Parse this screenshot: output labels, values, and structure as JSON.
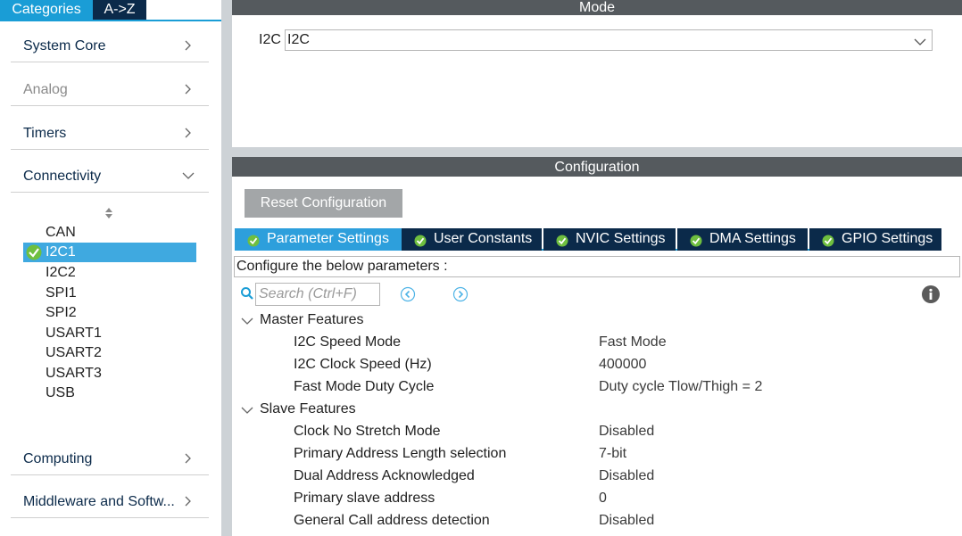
{
  "left_tabs": {
    "categories": "Categories",
    "az": "A->Z"
  },
  "categories": [
    {
      "label": "System Core",
      "state": "collapsed"
    },
    {
      "label": "Analog",
      "state": "collapsed"
    },
    {
      "label": "Timers",
      "state": "collapsed"
    },
    {
      "label": "Connectivity",
      "state": "expanded"
    },
    {
      "label": "Computing",
      "state": "collapsed"
    },
    {
      "label": "Middleware and Softw...",
      "state": "collapsed"
    }
  ],
  "connectivity_items": [
    "CAN",
    "I2C1",
    "I2C2",
    "SPI1",
    "SPI2",
    "USART1",
    "USART2",
    "USART3",
    "USB"
  ],
  "selected_item": "I2C1",
  "mode": {
    "header": "Mode",
    "label": "I2C",
    "value": "I2C"
  },
  "config": {
    "header": "Configuration",
    "reset_label": "Reset Configuration",
    "tabs": [
      "Parameter Settings",
      "User Constants",
      "NVIC Settings",
      "DMA Settings",
      "GPIO Settings"
    ],
    "active_tab": "Parameter Settings",
    "info_text": "Configure the below parameters :",
    "search_placeholder": "Search (Ctrl+F)",
    "groups": [
      {
        "label": "Master Features",
        "params": [
          {
            "name": "I2C Speed Mode",
            "value": "Fast Mode"
          },
          {
            "name": "I2C Clock Speed (Hz)",
            "value": "400000"
          },
          {
            "name": "Fast Mode Duty Cycle",
            "value": "Duty cycle Tlow/Thigh = 2"
          }
        ]
      },
      {
        "label": "Slave Features",
        "params": [
          {
            "name": "Clock No Stretch Mode",
            "value": "Disabled"
          },
          {
            "name": "Primary Address Length selection",
            "value": "7-bit"
          },
          {
            "name": "Dual Address Acknowledged",
            "value": "Disabled"
          },
          {
            "name": "Primary slave address",
            "value": "0"
          },
          {
            "name": "General Call address detection",
            "value": "Disabled"
          }
        ]
      }
    ]
  },
  "colors": {
    "accent": "#1a9dd6",
    "dark_tab": "#0b2a4a",
    "active_tab": "#2d9fdc",
    "header_bg": "#555a5e",
    "selected_item_bg": "#3fa9e0",
    "check_green": "#6fbf3f"
  },
  "icons": {
    "category_collapsed": "chevron-right-icon",
    "category_expanded": "chevron-down-icon",
    "selected_item": "check-circle-icon",
    "tab_status": "check-circle-icon",
    "search": "search-icon",
    "previous": "arrow-left-circle-icon",
    "next": "arrow-right-circle-icon",
    "help": "info-icon"
  }
}
